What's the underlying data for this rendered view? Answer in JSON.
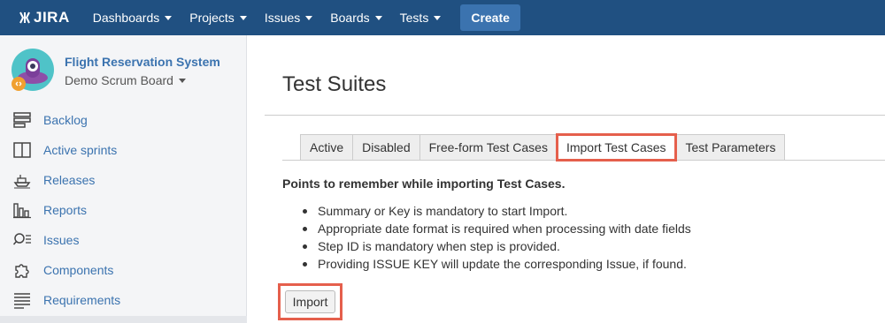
{
  "topnav": {
    "logo_text": "JIRA",
    "items": [
      {
        "label": "Dashboards"
      },
      {
        "label": "Projects"
      },
      {
        "label": "Issues"
      },
      {
        "label": "Boards"
      },
      {
        "label": "Tests"
      }
    ],
    "create_label": "Create"
  },
  "sidebar": {
    "project_name": "Flight Reservation System",
    "board_name": "Demo Scrum Board",
    "items": [
      {
        "label": "Backlog",
        "icon": "backlog-icon"
      },
      {
        "label": "Active sprints",
        "icon": "board-columns-icon"
      },
      {
        "label": "Releases",
        "icon": "ship-icon"
      },
      {
        "label": "Reports",
        "icon": "bar-chart-icon"
      },
      {
        "label": "Issues",
        "icon": "search-list-icon"
      },
      {
        "label": "Components",
        "icon": "puzzle-icon"
      },
      {
        "label": "Requirements",
        "icon": "lines-icon"
      }
    ]
  },
  "main": {
    "title": "Test Suites",
    "tabs": [
      {
        "label": "Active"
      },
      {
        "label": "Disabled"
      },
      {
        "label": "Free-form Test Cases"
      },
      {
        "label": "Import Test Cases",
        "active": true
      },
      {
        "label": "Test Parameters"
      }
    ],
    "points_title": "Points to remember while importing Test Cases.",
    "points": [
      "Summary or Key is mandatory to start Import.",
      "Appropriate date format is required when processing with date fields",
      "Step ID is mandatory when step is provided.",
      "Providing ISSUE KEY will update the corresponding Issue, if found."
    ],
    "import_label": "Import"
  },
  "colors": {
    "topbar": "#205081",
    "link": "#3b73af",
    "highlight": "#e55f4c"
  }
}
